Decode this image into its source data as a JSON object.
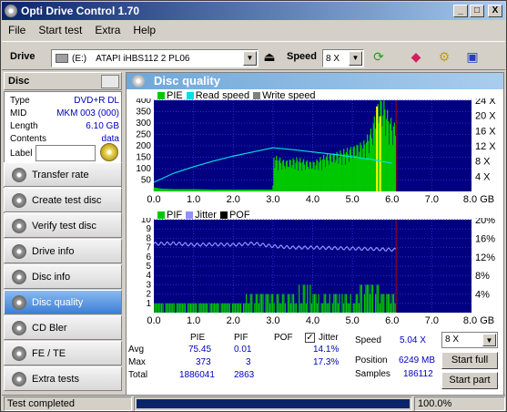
{
  "window": {
    "title": "Opti Drive Control 1.70",
    "minimize": "_",
    "maximize": "□",
    "close": "X"
  },
  "menu": [
    "File",
    "Start test",
    "Extra",
    "Help"
  ],
  "toolbar": {
    "drive_label": "Drive",
    "drive_letter": "(E:)",
    "drive_name": "ATAPI  iHBS112   2 PL06",
    "speed_label": "Speed",
    "speed_value": "8 X"
  },
  "sidebar": {
    "disc_header": "Disc",
    "info": [
      {
        "label": "Type",
        "value": "DVD+R DL"
      },
      {
        "label": "MID",
        "value": "MKM 003 (000)"
      },
      {
        "label": "Length",
        "value": "6.10 GB"
      },
      {
        "label": "Contents",
        "value": "data"
      },
      {
        "label": "Label",
        "value": ""
      }
    ],
    "nav": [
      {
        "label": "Transfer rate",
        "active": false
      },
      {
        "label": "Create test disc",
        "active": false
      },
      {
        "label": "Verify test disc",
        "active": false
      },
      {
        "label": "Drive info",
        "active": false
      },
      {
        "label": "Disc info",
        "active": false
      },
      {
        "label": "Disc quality",
        "active": true
      },
      {
        "label": "CD Bler",
        "active": false
      },
      {
        "label": "FE / TE",
        "active": false
      },
      {
        "label": "Extra tests",
        "active": false
      }
    ]
  },
  "main": {
    "title": "Disc quality"
  },
  "colors": {
    "pie": "#00c800",
    "pif": "#00c800",
    "read_speed": "#00e0e0",
    "write_speed": "#808080",
    "jitter": "#9090ff",
    "pof": "#000000",
    "plot_bg": "#000080",
    "grid": "#2a2acf",
    "spike": "#ffff00"
  },
  "chart_data": [
    {
      "type": "area",
      "legend": [
        "PIE",
        "Read speed",
        "Write speed"
      ],
      "x_ticks": [
        "0.0",
        "1.0",
        "2.0",
        "3.0",
        "4.0",
        "5.0",
        "6.0",
        "7.0",
        "8.0 GB"
      ],
      "xlim": [
        0,
        8
      ],
      "ylim_left": [
        0,
        400
      ],
      "y_ticks_left": [
        "400",
        "350",
        "300",
        "250",
        "200",
        "150",
        "100",
        "50"
      ],
      "y_ticks_right": [
        "24 X",
        "20 X",
        "16 X",
        "12 X",
        "8 X",
        "4 X"
      ],
      "ylim_right": [
        0,
        24
      ],
      "series": [
        {
          "name": "PIE",
          "x": [
            0,
            0.2,
            0.5,
            1.0,
            1.5,
            2.0,
            2.5,
            3.0,
            3.02,
            3.3,
            3.6,
            4.0,
            4.3,
            4.6,
            5.0,
            5.3,
            5.5,
            5.6,
            5.7,
            5.8,
            5.9,
            6.0,
            6.1
          ],
          "values": [
            18,
            12,
            10,
            10,
            8,
            8,
            8,
            8,
            130,
            110,
            120,
            105,
            130,
            140,
            160,
            180,
            230,
            300,
            340,
            320,
            280,
            250,
            240
          ]
        },
        {
          "name": "Read speed",
          "x": [
            0,
            0.5,
            1.0,
            1.5,
            2.0,
            2.5,
            3.0,
            3.5,
            4.0,
            4.5,
            5.0,
            5.5,
            6.0
          ],
          "values": [
            2.4,
            4.8,
            6.5,
            8.0,
            9.3,
            10.4,
            11.5,
            11.0,
            10.4,
            9.8,
            9.1,
            8.4,
            7.4
          ]
        }
      ],
      "annotations": [
        "spikes near 5.6-5.7 GB reach 373"
      ]
    },
    {
      "type": "bar",
      "legend": [
        "PIF",
        "Jitter",
        "POF"
      ],
      "x_ticks": [
        "0.0",
        "1.0",
        "2.0",
        "3.0",
        "4.0",
        "5.0",
        "6.0",
        "7.0",
        "8.0 GB"
      ],
      "xlim": [
        0,
        8
      ],
      "ylim_left": [
        0,
        10
      ],
      "y_ticks_left": [
        "10",
        "9",
        "8",
        "7",
        "6",
        "5",
        "4",
        "3",
        "2",
        "1"
      ],
      "y_ticks_right": [
        "20%",
        "16%",
        "12%",
        "8%",
        "4%"
      ],
      "ylim_right": [
        0,
        20
      ],
      "series": [
        {
          "name": "PIF",
          "x": [
            0.3,
            0.8,
            1.4,
            2.0,
            2.6,
            3.1,
            3.4,
            3.8,
            4.2,
            4.6,
            5.0,
            5.3,
            5.6,
            5.8,
            6.0
          ],
          "values": [
            1,
            1,
            1,
            1,
            2,
            2,
            2,
            3,
            2,
            2,
            2,
            3,
            3,
            2,
            2
          ]
        },
        {
          "name": "Jitter",
          "x": [
            0,
            0.5,
            1.0,
            1.5,
            2.0,
            2.5,
            3.0,
            3.5,
            4.0,
            4.5,
            5.0,
            5.5,
            6.1
          ],
          "values": [
            14.8,
            14.9,
            14.6,
            14.7,
            14.6,
            14.9,
            14.3,
            14.0,
            14.0,
            13.9,
            13.8,
            13.7,
            13.5
          ]
        }
      ]
    }
  ],
  "stats": {
    "headers": [
      "PIE",
      "PIF",
      "POF",
      "Jitter"
    ],
    "rows": [
      {
        "label": "Avg",
        "pie": "75.45",
        "pif": "0.01",
        "pof": "",
        "jitter": "14.1%"
      },
      {
        "label": "Max",
        "pie": "373",
        "pif": "3",
        "pof": "",
        "jitter": "17.3%"
      },
      {
        "label": "Total",
        "pie": "1886041",
        "pif": "2863",
        "pof": "",
        "jitter": ""
      }
    ],
    "speed_label": "Speed",
    "speed_value": "5.04 X",
    "position_label": "Position",
    "position_value": "6249 MB",
    "samples_label": "Samples",
    "samples_value": "186112",
    "speed_select": "8 X",
    "start_full": "Start full",
    "start_part": "Start part"
  },
  "status": {
    "text": "Test completed",
    "progress_text": "100.0%",
    "progress": 1.0
  }
}
